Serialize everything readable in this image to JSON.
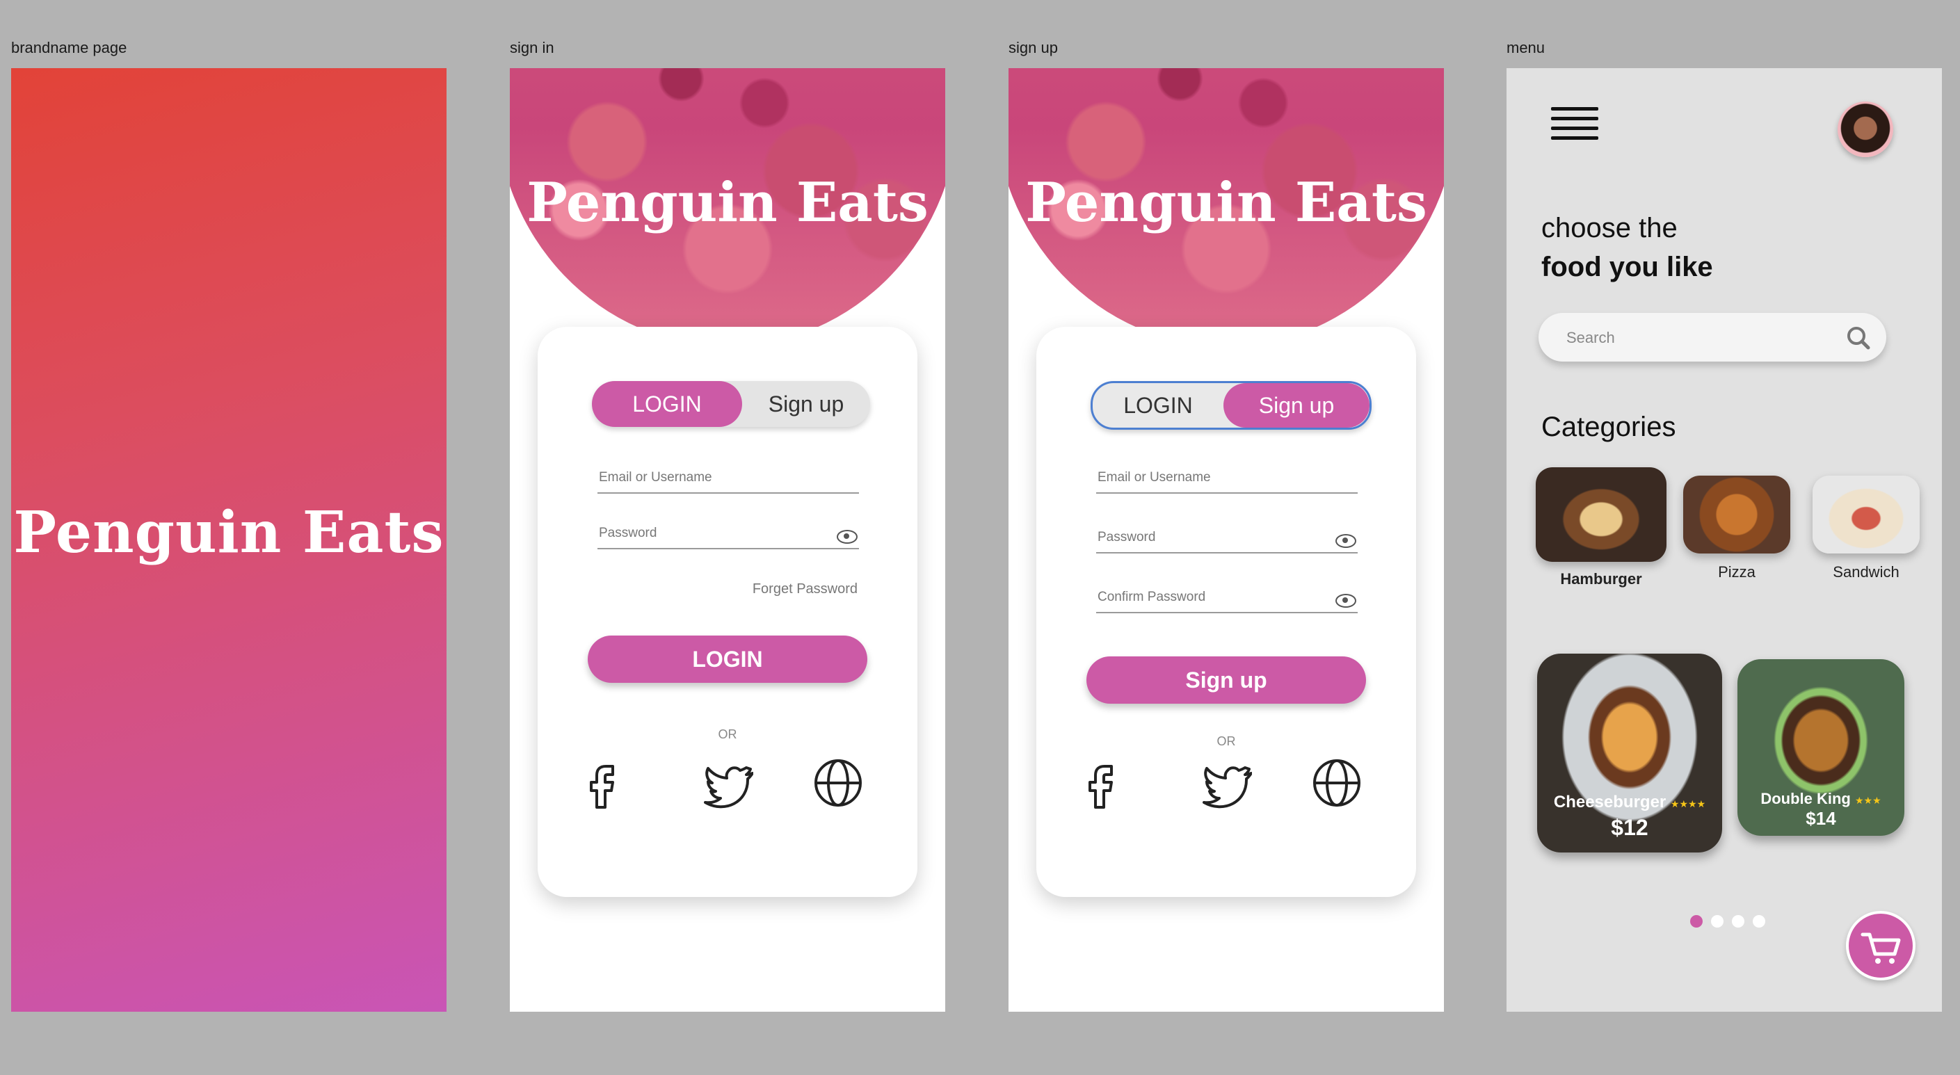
{
  "frames": {
    "brand": {
      "label": "brandname page",
      "logo": "Penguin Eats"
    },
    "signin": {
      "label": "sign in",
      "title": "Penguin Eats",
      "toggle_login": "LOGIN",
      "toggle_signup": "Sign up",
      "email_placeholder": "Email or Username",
      "password_placeholder": "Password",
      "forgot": "Forget Password",
      "cta": "LOGIN",
      "or": "OR"
    },
    "signup": {
      "label": "sign up",
      "title": "Penguin Eats",
      "toggle_login": "LOGIN",
      "toggle_signup": "Sign up",
      "email_placeholder": "Email or Username",
      "password_placeholder": "Password",
      "confirm_placeholder": "Confirm Password",
      "cta": "Sign up",
      "or": "OR"
    },
    "menu": {
      "label": "menu",
      "greeting_line1": "choose the",
      "greeting_line2": "food you like",
      "search_placeholder": "Search",
      "categories_title": "Categories",
      "categories": [
        {
          "label": "Hamburger"
        },
        {
          "label": "Pizza"
        },
        {
          "label": "Sandwich"
        }
      ],
      "items": [
        {
          "name": "Cheeseburger",
          "stars": "★★★★",
          "price": "$12"
        },
        {
          "name": "Double King",
          "stars": "★★★",
          "price": "$14"
        }
      ],
      "pagination": {
        "count": 4,
        "active": 1
      }
    }
  },
  "colors": {
    "accent": "#cc5aa6",
    "brand_gradient_top": "#e24338",
    "brand_gradient_bottom": "#c955b6",
    "toggle_outline": "#4d7fd1",
    "star": "#f5c518"
  },
  "icons": [
    "facebook-icon",
    "twitter-icon",
    "globe-icon",
    "eye-icon",
    "search-icon",
    "hamburger-menu-icon",
    "cart-icon"
  ]
}
